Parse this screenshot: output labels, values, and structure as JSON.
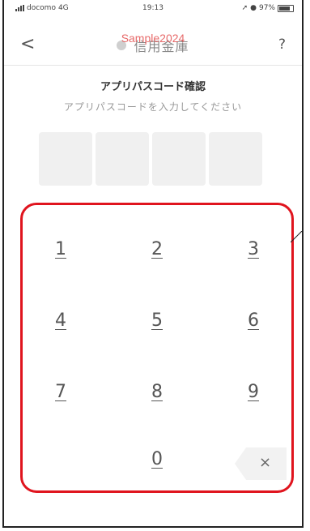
{
  "status_bar": {
    "carrier": "docomo",
    "network": "4G",
    "time": "19:13",
    "battery": "97%"
  },
  "header": {
    "back_label": "<",
    "bank_name": "信用金庫",
    "watermark": "Sample2024",
    "help_label": "?"
  },
  "title": "アプリパスコード確認",
  "subtitle": "アプリパスコードを入力してください",
  "keypad": {
    "keys": [
      "1",
      "2",
      "3",
      "4",
      "5",
      "6",
      "7",
      "8",
      "9",
      "0"
    ],
    "delete_label": "×"
  },
  "colors": {
    "highlight": "#e0141e",
    "watermark": "#e24646"
  }
}
